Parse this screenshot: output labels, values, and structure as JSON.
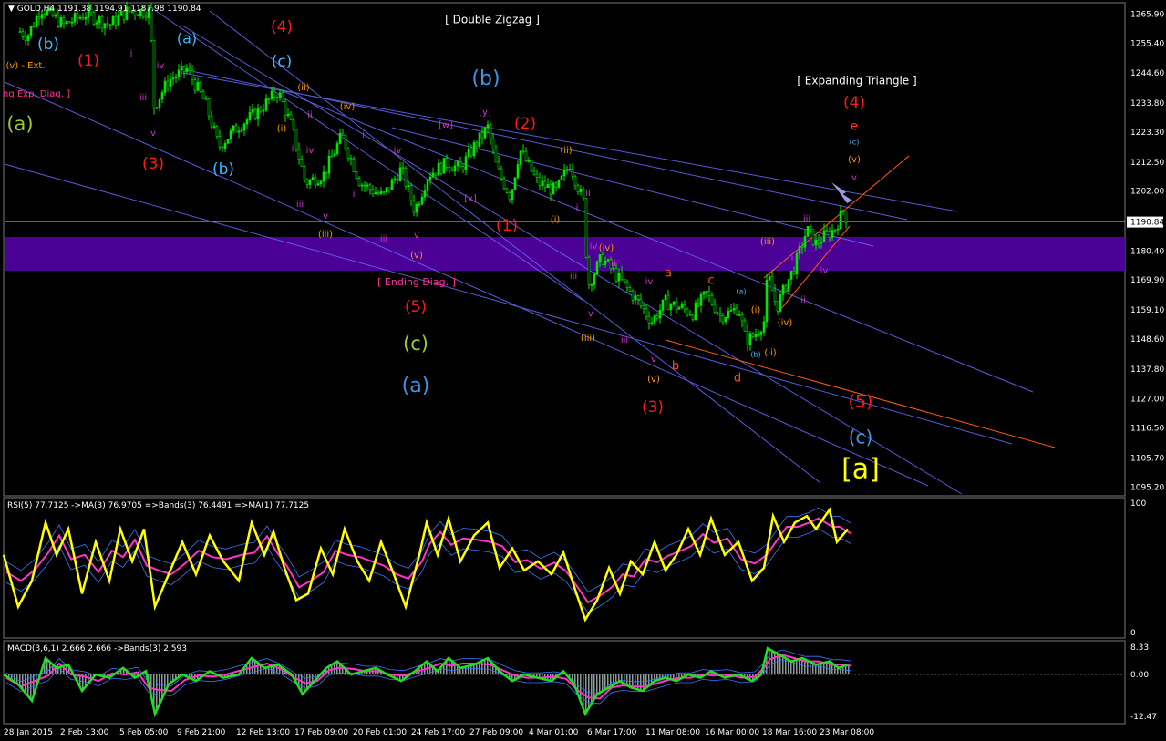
{
  "chart_data": {
    "type": "candlestick",
    "symbol_timeframe": "GOLD,H4",
    "ohlc": [
      "1191.38",
      "1194.91",
      "1187.98",
      "1190.84"
    ],
    "price_ticks": [
      "1265.90",
      "1255.40",
      "1244.60",
      "1233.80",
      "1223.30",
      "1212.50",
      "1202.00",
      "1190.84",
      "1180.40",
      "1169.90",
      "1159.10",
      "1148.60",
      "1137.80",
      "1127.00",
      "1116.50",
      "1105.70",
      "1095.20"
    ],
    "current_price": 1190.84,
    "ylim": [
      1092,
      1270
    ],
    "date_ticks": [
      "28 Jan 2015",
      "2 Feb 13:00",
      "5 Feb 05:00",
      "9 Feb 21:00",
      "12 Feb 13:00",
      "17 Feb 09:00",
      "20 Feb 01:00",
      "24 Feb 17:00",
      "27 Feb 09:00",
      "4 Mar 01:00",
      "6 Mar 17:00",
      "11 Mar 08:00",
      "16 Mar 00:00",
      "18 Mar 16:00",
      "23 Mar 08:00"
    ],
    "price_path": [
      [
        0,
        1250
      ],
      [
        10,
        1262
      ],
      [
        30,
        1258
      ],
      [
        45,
        1268
      ],
      [
        70,
        1262
      ],
      [
        95,
        1266
      ],
      [
        120,
        1262
      ],
      [
        140,
        1267
      ],
      [
        165,
        1267
      ],
      [
        168,
        1232
      ],
      [
        185,
        1242
      ],
      [
        205,
        1246
      ],
      [
        225,
        1234
      ],
      [
        240,
        1218
      ],
      [
        260,
        1225
      ],
      [
        280,
        1230
      ],
      [
        305,
        1238
      ],
      [
        320,
        1225
      ],
      [
        335,
        1205
      ],
      [
        355,
        1208
      ],
      [
        375,
        1222
      ],
      [
        395,
        1205
      ],
      [
        420,
        1200
      ],
      [
        440,
        1210
      ],
      [
        455,
        1195
      ],
      [
        470,
        1208
      ],
      [
        490,
        1212
      ],
      [
        505,
        1210
      ],
      [
        520,
        1218
      ],
      [
        535,
        1225
      ],
      [
        545,
        1210
      ],
      [
        560,
        1200
      ],
      [
        570,
        1217
      ],
      [
        590,
        1205
      ],
      [
        610,
        1202
      ],
      [
        625,
        1212
      ],
      [
        640,
        1198
      ],
      [
        645,
        1168
      ],
      [
        660,
        1178
      ],
      [
        680,
        1170
      ],
      [
        700,
        1162
      ],
      [
        715,
        1155
      ],
      [
        730,
        1162
      ],
      [
        745,
        1160
      ],
      [
        760,
        1158
      ],
      [
        775,
        1165
      ],
      [
        790,
        1157
      ],
      [
        800,
        1158
      ],
      [
        810,
        1160
      ],
      [
        818,
        1148
      ],
      [
        828,
        1150
      ],
      [
        838,
        1155
      ],
      [
        842,
        1172
      ],
      [
        852,
        1160
      ],
      [
        862,
        1168
      ],
      [
        872,
        1175
      ],
      [
        885,
        1188
      ],
      [
        895,
        1183
      ],
      [
        905,
        1186
      ],
      [
        915,
        1188
      ],
      [
        925,
        1195
      ],
      [
        930,
        1191
      ]
    ],
    "rsi": {
      "label": "RSI(5) 77.7125  ->MA(3) 76.9705  =>Bands(3) 76.4491  =>MA(1) 77.7125",
      "ticks": [
        "100",
        "0"
      ],
      "points": [
        [
          4,
          60
        ],
        [
          20,
          20
        ],
        [
          35,
          40
        ],
        [
          50,
          85
        ],
        [
          62,
          60
        ],
        [
          75,
          80
        ],
        [
          90,
          30
        ],
        [
          105,
          70
        ],
        [
          120,
          40
        ],
        [
          132,
          80
        ],
        [
          145,
          55
        ],
        [
          158,
          80
        ],
        [
          170,
          20
        ],
        [
          185,
          45
        ],
        [
          200,
          70
        ],
        [
          215,
          45
        ],
        [
          230,
          75
        ],
        [
          245,
          55
        ],
        [
          262,
          40
        ],
        [
          276,
          85
        ],
        [
          290,
          60
        ],
        [
          300,
          78
        ],
        [
          312,
          50
        ],
        [
          325,
          25
        ],
        [
          338,
          30
        ],
        [
          352,
          65
        ],
        [
          365,
          45
        ],
        [
          378,
          80
        ],
        [
          392,
          55
        ],
        [
          405,
          40
        ],
        [
          418,
          70
        ],
        [
          432,
          45
        ],
        [
          445,
          20
        ],
        [
          460,
          60
        ],
        [
          468,
          85
        ],
        [
          480,
          60
        ],
        [
          492,
          88
        ],
        [
          505,
          55
        ],
        [
          520,
          75
        ],
        [
          535,
          85
        ],
        [
          548,
          50
        ],
        [
          562,
          65
        ],
        [
          575,
          48
        ],
        [
          590,
          55
        ],
        [
          605,
          45
        ],
        [
          618,
          62
        ],
        [
          630,
          35
        ],
        [
          642,
          10
        ],
        [
          655,
          25
        ],
        [
          668,
          50
        ],
        [
          680,
          30
        ],
        [
          692,
          55
        ],
        [
          705,
          45
        ],
        [
          718,
          70
        ],
        [
          730,
          48
        ],
        [
          742,
          60
        ],
        [
          755,
          80
        ],
        [
          768,
          60
        ],
        [
          780,
          88
        ],
        [
          795,
          60
        ],
        [
          810,
          70
        ],
        [
          825,
          40
        ],
        [
          838,
          50
        ],
        [
          848,
          90
        ],
        [
          860,
          70
        ],
        [
          872,
          85
        ],
        [
          885,
          90
        ],
        [
          895,
          80
        ],
        [
          910,
          95
        ],
        [
          918,
          70
        ],
        [
          930,
          80
        ]
      ]
    },
    "macd": {
      "label": "MACD(3,6,1) 2.666 2.666  ->Bands(3) 2.593",
      "ticks": [
        "8.33",
        "0.00",
        "-12.47"
      ],
      "points": [
        [
          4,
          0
        ],
        [
          20,
          -3
        ],
        [
          35,
          -8
        ],
        [
          50,
          5
        ],
        [
          62,
          2
        ],
        [
          75,
          3
        ],
        [
          90,
          -5
        ],
        [
          105,
          0
        ],
        [
          120,
          -1
        ],
        [
          135,
          2
        ],
        [
          148,
          -1
        ],
        [
          160,
          1
        ],
        [
          170,
          -12
        ],
        [
          185,
          -3
        ],
        [
          200,
          0
        ],
        [
          215,
          -2
        ],
        [
          230,
          1
        ],
        [
          245,
          -1
        ],
        [
          262,
          0
        ],
        [
          276,
          5
        ],
        [
          290,
          2
        ],
        [
          305,
          3
        ],
        [
          320,
          0
        ],
        [
          332,
          -6
        ],
        [
          345,
          -2
        ],
        [
          358,
          2
        ],
        [
          370,
          4
        ],
        [
          385,
          0
        ],
        [
          398,
          1
        ],
        [
          412,
          2
        ],
        [
          425,
          0
        ],
        [
          440,
          -2
        ],
        [
          455,
          1
        ],
        [
          468,
          4
        ],
        [
          480,
          1
        ],
        [
          492,
          5
        ],
        [
          505,
          2
        ],
        [
          520,
          3
        ],
        [
          535,
          5
        ],
        [
          548,
          1
        ],
        [
          562,
          -2
        ],
        [
          575,
          0
        ],
        [
          590,
          -1
        ],
        [
          605,
          -2
        ],
        [
          618,
          1
        ],
        [
          630,
          -3
        ],
        [
          642,
          -12
        ],
        [
          655,
          -6
        ],
        [
          668,
          -4
        ],
        [
          680,
          -2
        ],
        [
          692,
          -4
        ],
        [
          705,
          -5
        ],
        [
          718,
          -2
        ],
        [
          730,
          -1
        ],
        [
          742,
          -2
        ],
        [
          755,
          0
        ],
        [
          768,
          -1
        ],
        [
          780,
          1
        ],
        [
          795,
          -1
        ],
        [
          810,
          0
        ],
        [
          825,
          -2
        ],
        [
          835,
          0
        ],
        [
          842,
          8
        ],
        [
          855,
          6
        ],
        [
          868,
          4
        ],
        [
          880,
          5
        ],
        [
          895,
          3
        ],
        [
          910,
          4
        ],
        [
          920,
          2
        ],
        [
          930,
          3
        ]
      ]
    },
    "wave_labels": [
      {
        "t": "(b)",
        "c": "#3cb8ff",
        "x": 53,
        "y": 49,
        "s": 17
      },
      {
        "t": "(a)",
        "c": "#3cb8ff",
        "x": 205,
        "y": 43,
        "s": 16
      },
      {
        "t": "(4)",
        "c": "#ff1a1a",
        "x": 309,
        "y": 30,
        "s": 17
      },
      {
        "t": "(c)",
        "c": "#3cb8ff",
        "x": 309,
        "y": 68,
        "s": 17
      },
      {
        "t": "(1)",
        "c": "#ff1a1a",
        "x": 97,
        "y": 67,
        "s": 17
      },
      {
        "t": "(v) - Ext.",
        "c": "#ff9900",
        "x": 28,
        "y": 72,
        "s": 10
      },
      {
        "t": "ng Exp. Diag. ]",
        "c": "#ff3399",
        "x": 40,
        "y": 103,
        "s": 10
      },
      {
        "t": "(a)",
        "c": "#99cc33",
        "x": 22,
        "y": 137,
        "s": 21
      },
      {
        "t": "(3)",
        "c": "#ff1a1a",
        "x": 168,
        "y": 180,
        "s": 17
      },
      {
        "t": "(b)",
        "c": "#3cb8ff",
        "x": 245,
        "y": 186,
        "s": 17
      },
      {
        "t": "[ Double Zigzag ]",
        "c": "#ffffff",
        "x": 540,
        "y": 22,
        "s": 12
      },
      {
        "t": "(b)",
        "c": "#3c96e6",
        "x": 533,
        "y": 87,
        "s": 22
      },
      {
        "t": "(2)",
        "c": "#ff1a1a",
        "x": 576,
        "y": 136,
        "s": 17
      },
      {
        "t": "(1)",
        "c": "#ff1a1a",
        "x": 556,
        "y": 248,
        "s": 17
      },
      {
        "t": "[ Ending Diag. ]",
        "c": "#ff3399",
        "x": 457,
        "y": 310,
        "s": 11
      },
      {
        "t": "(5)",
        "c": "#ff1a1a",
        "x": 456,
        "y": 337,
        "s": 17
      },
      {
        "t": "(c)",
        "c": "#99cc33",
        "x": 456,
        "y": 378,
        "s": 21
      },
      {
        "t": "(a)",
        "c": "#3c96e6",
        "x": 456,
        "y": 424,
        "s": 22
      },
      {
        "t": "(3)",
        "c": "#ff1a1a",
        "x": 716,
        "y": 447,
        "s": 17
      },
      {
        "t": "[ Expanding Triangle ]",
        "c": "#ffffff",
        "x": 940,
        "y": 89,
        "s": 12
      },
      {
        "t": "(4)",
        "c": "#ff1a1a",
        "x": 937,
        "y": 113,
        "s": 17
      },
      {
        "t": "e",
        "c": "#ff3333",
        "x": 937,
        "y": 139,
        "s": 13
      },
      {
        "t": "(c)",
        "c": "#3cb8ff",
        "x": 937,
        "y": 156,
        "s": 8
      },
      {
        "t": "(v)",
        "c": "#ff9900",
        "x": 937,
        "y": 175,
        "s": 10
      },
      {
        "t": "v",
        "c": "#cc33cc",
        "x": 937,
        "y": 195,
        "s": 10
      },
      {
        "t": "(5)",
        "c": "#ff1a1a",
        "x": 944,
        "y": 441,
        "s": 19
      },
      {
        "t": "(c)",
        "c": "#3c96e6",
        "x": 944,
        "y": 481,
        "s": 20
      },
      {
        "t": "[a]",
        "c": "#ffff00",
        "x": 944,
        "y": 516,
        "s": 30
      },
      {
        "t": "(ii)",
        "c": "#ff9900",
        "x": 333,
        "y": 96,
        "s": 10
      },
      {
        "t": "(iv)",
        "c": "#ff9900",
        "x": 381,
        "y": 117,
        "s": 10
      },
      {
        "t": "(i)",
        "c": "#ff9900",
        "x": 309,
        "y": 141,
        "s": 10
      },
      {
        "t": "(iii)",
        "c": "#ff9900",
        "x": 357,
        "y": 257,
        "s": 10
      },
      {
        "t": "(v)",
        "c": "#ff9900",
        "x": 457,
        "y": 280,
        "s": 10
      },
      {
        "t": "(i)",
        "c": "#ff9900",
        "x": 609,
        "y": 241,
        "s": 10
      },
      {
        "t": "(ii)",
        "c": "#ff9900",
        "x": 621,
        "y": 165,
        "s": 10
      },
      {
        "t": "(iv)",
        "c": "#ff9900",
        "x": 665,
        "y": 272,
        "s": 10
      },
      {
        "t": "(iii)",
        "c": "#ff9900",
        "x": 645,
        "y": 371,
        "s": 10
      },
      {
        "t": "(v)",
        "c": "#ff9900",
        "x": 717,
        "y": 416,
        "s": 10
      },
      {
        "t": "(iii)",
        "c": "#ff9900",
        "x": 842,
        "y": 265,
        "s": 10
      },
      {
        "t": "(i)",
        "c": "#ff9900",
        "x": 829,
        "y": 340,
        "s": 10
      },
      {
        "t": "(iv)",
        "c": "#ff9900",
        "x": 861,
        "y": 354,
        "s": 10
      },
      {
        "t": "(ii)",
        "c": "#ff9900",
        "x": 845,
        "y": 387,
        "s": 10
      },
      {
        "t": "[w]",
        "c": "#cc33cc",
        "x": 489,
        "y": 137,
        "s": 10
      },
      {
        "t": "[y]",
        "c": "#cc33cc",
        "x": 532,
        "y": 123,
        "s": 10
      },
      {
        "t": "[x]",
        "c": "#cc33cc",
        "x": 516,
        "y": 218,
        "s": 10
      },
      {
        "t": "a",
        "c": "#ff4d1a",
        "x": 733,
        "y": 300,
        "s": 13
      },
      {
        "t": "b",
        "c": "#ff4d1a",
        "x": 741,
        "y": 402,
        "s": 13
      },
      {
        "t": "c",
        "c": "#ff4d1a",
        "x": 780,
        "y": 308,
        "s": 13
      },
      {
        "t": "d",
        "c": "#ff4d1a",
        "x": 809,
        "y": 415,
        "s": 13
      },
      {
        "t": "(a)",
        "c": "#3cb8ff",
        "x": 813,
        "y": 320,
        "s": 8
      },
      {
        "t": "(b)",
        "c": "#3cb8ff",
        "x": 829,
        "y": 389,
        "s": 8
      },
      {
        "t": "i",
        "c": "#cc33cc",
        "x": 144,
        "y": 59,
        "s": 10
      },
      {
        "t": "iv",
        "c": "#cc33cc",
        "x": 176,
        "y": 72,
        "s": 10
      },
      {
        "t": "iii",
        "c": "#cc33cc",
        "x": 157,
        "y": 107,
        "s": 10
      },
      {
        "t": "v",
        "c": "#cc33cc",
        "x": 168,
        "y": 146,
        "s": 10
      },
      {
        "t": "ii",
        "c": "#cc33cc",
        "x": 340,
        "y": 126,
        "s": 10
      },
      {
        "t": "i",
        "c": "#cc33cc",
        "x": 321,
        "y": 163,
        "s": 10
      },
      {
        "t": "iv",
        "c": "#cc33cc",
        "x": 340,
        "y": 165,
        "s": 10
      },
      {
        "t": "ii",
        "c": "#cc33cc",
        "x": 400,
        "y": 148,
        "s": 10
      },
      {
        "t": "iv",
        "c": "#cc33cc",
        "x": 436,
        "y": 165,
        "s": 10
      },
      {
        "t": "iii",
        "c": "#cc33cc",
        "x": 329,
        "y": 224,
        "s": 10
      },
      {
        "t": "v",
        "c": "#cc33cc",
        "x": 357,
        "y": 237,
        "s": 10
      },
      {
        "t": "i",
        "c": "#cc33cc",
        "x": 388,
        "y": 213,
        "s": 10
      },
      {
        "t": "iii",
        "c": "#cc33cc",
        "x": 421,
        "y": 262,
        "s": 10
      },
      {
        "t": "v",
        "c": "#cc33cc",
        "x": 457,
        "y": 258,
        "s": 10
      },
      {
        "t": "ii",
        "c": "#cc33cc",
        "x": 645,
        "y": 212,
        "s": 10
      },
      {
        "t": "i",
        "c": "#cc33cc",
        "x": 633,
        "y": 228,
        "s": 10
      },
      {
        "t": "iv",
        "c": "#cc33cc",
        "x": 651,
        "y": 270,
        "s": 10
      },
      {
        "t": "ii",
        "c": "#cc33cc",
        "x": 673,
        "y": 289,
        "s": 10
      },
      {
        "t": "iii",
        "c": "#cc33cc",
        "x": 629,
        "y": 303,
        "s": 10
      },
      {
        "t": "iv",
        "c": "#cc33cc",
        "x": 712,
        "y": 309,
        "s": 10
      },
      {
        "t": "v",
        "c": "#cc33cc",
        "x": 648,
        "y": 344,
        "s": 10
      },
      {
        "t": "iii",
        "c": "#cc33cc",
        "x": 685,
        "y": 373,
        "s": 10
      },
      {
        "t": "v",
        "c": "#cc33cc",
        "x": 717,
        "y": 394,
        "s": 10
      },
      {
        "t": "iii",
        "c": "#cc33cc",
        "x": 885,
        "y": 240,
        "s": 10
      },
      {
        "t": "i",
        "c": "#cc33cc",
        "x": 869,
        "y": 283,
        "s": 10
      },
      {
        "t": "iv",
        "c": "#cc33cc",
        "x": 904,
        "y": 297,
        "s": 10
      },
      {
        "t": "ii",
        "c": "#cc33cc",
        "x": 881,
        "y": 329,
        "s": 10
      }
    ]
  }
}
